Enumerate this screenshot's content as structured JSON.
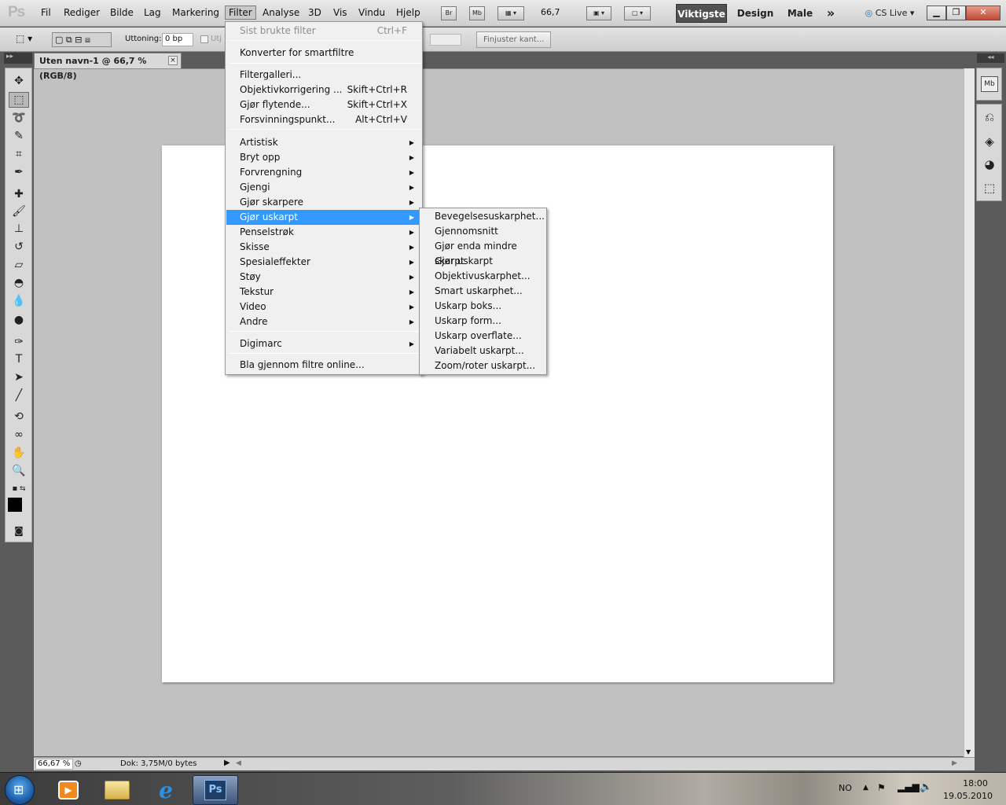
{
  "menubar": {
    "logo": "Ps",
    "items": [
      "Fil",
      "Rediger",
      "Bilde",
      "Lag",
      "Markering",
      "Filter",
      "Analyse",
      "3D",
      "Vis",
      "Vindu",
      "Hjelp"
    ],
    "active": "Filter",
    "bridge_label": "Br",
    "minibridge_label": "Mb",
    "zoom_value": "66,7",
    "workspaces": [
      "Viktigste",
      "Design",
      "Male"
    ],
    "active_workspace": "Viktigste",
    "more": "»",
    "cs_live": "CS Live"
  },
  "options": {
    "feather_label": "Uttoning:",
    "feather_value": "0 bp",
    "antialias_label": "Utj",
    "refine_edge": "Finjuster kant..."
  },
  "document": {
    "tab_title": "Uten navn-1 @ 66,7 % (RGB/8)",
    "close": "×"
  },
  "status": {
    "zoom": "66,67 %",
    "doc_info": "Dok: 3,75M/0 bytes"
  },
  "filter_menu": {
    "last_filter": {
      "label": "Sist brukte filter",
      "shortcut": "Ctrl+F"
    },
    "convert": "Konverter for smartfiltre",
    "top_items": [
      {
        "label": "Filtergalleri...",
        "shortcut": ""
      },
      {
        "label": "Objektivkorrigering ...",
        "shortcut": "Skift+Ctrl+R"
      },
      {
        "label": "Gjør flytende...",
        "shortcut": "Skift+Ctrl+X"
      },
      {
        "label": "Forsvinningspunkt...",
        "shortcut": "Alt+Ctrl+V"
      }
    ],
    "categories": [
      "Artistisk",
      "Bryt opp",
      "Forvrengning",
      "Gjengi",
      "Gjør skarpere",
      "Gjør uskarpt",
      "Penselstrøk",
      "Skisse",
      "Spesialeffekter",
      "Støy",
      "Tekstur",
      "Video",
      "Andre"
    ],
    "highlighted": "Gjør uskarpt",
    "digimarc": "Digimarc",
    "browse_online": "Bla gjennom filtre online..."
  },
  "blur_submenu": {
    "items": [
      "Bevegelsesuskarphet...",
      "Gjennomsnitt",
      "Gjør enda mindre skarpt",
      "Gjør uskarpt",
      "Objektivuskarphet...",
      "Smart uskarphet...",
      "Uskarp boks...",
      "Uskarp form...",
      "Uskarp overflate...",
      "Variabelt uskarpt...",
      "Zoom/roter uskarpt..."
    ]
  },
  "taskbar": {
    "lang": "NO",
    "time": "18:00",
    "date": "19.05.2010",
    "ps_label": "Ps"
  },
  "colors": {
    "highlight": "#3399ff",
    "canvas_bg": "#c1c1c1",
    "ps_blue": "#1f3e66"
  }
}
